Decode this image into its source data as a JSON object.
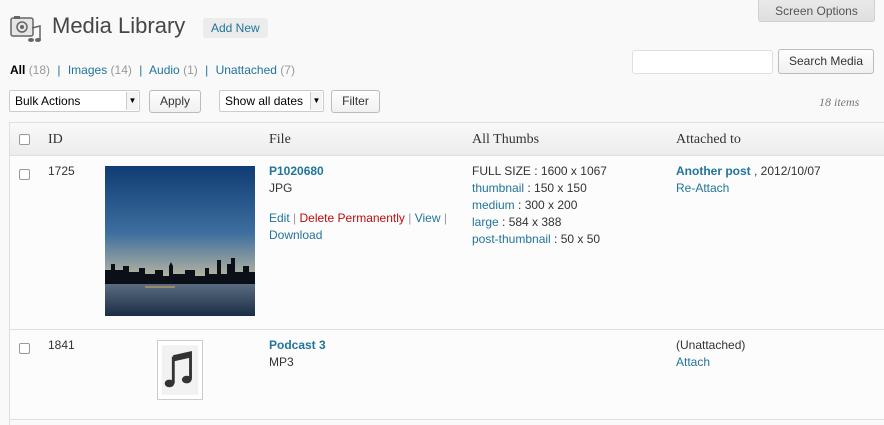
{
  "header": {
    "title": "Media Library",
    "add_new": "Add New",
    "screen_options": "Screen Options"
  },
  "filters": {
    "all": {
      "label": "All",
      "count": "(18)"
    },
    "images": {
      "label": "Images",
      "count": "(14)"
    },
    "audio": {
      "label": "Audio",
      "count": "(1)"
    },
    "unattached": {
      "label": "Unattached",
      "count": "(7)"
    }
  },
  "search": {
    "button": "Search Media",
    "value": ""
  },
  "toolbar": {
    "bulk_actions": "Bulk Actions",
    "apply": "Apply",
    "dates": "Show all dates",
    "filter": "Filter",
    "items_count": "18 items"
  },
  "table": {
    "headers": {
      "id": "ID",
      "file": "File",
      "thumbs": "All Thumbs",
      "attached": "Attached to"
    },
    "rows": [
      {
        "id": "1725",
        "title": "P1020680",
        "type": "JPG",
        "actions": {
          "edit": "Edit",
          "delete": "Delete Permanently",
          "view": "View",
          "download": "Download"
        },
        "thumbs": {
          "full": "FULL SIZE : 1600 x 1067",
          "thumbnail": {
            "label": "thumbnail",
            "size": " : 150 x 150"
          },
          "medium": {
            "label": "medium",
            "size": " : 300 x 200"
          },
          "large": {
            "label": "large",
            "size": " : 584 x 388"
          },
          "post_thumbnail": {
            "label": "post-thumbnail",
            "size": " : 50 x 50"
          }
        },
        "attached": {
          "post": "Another post",
          "date": " , 2012/10/07",
          "action": "Re-Attach"
        }
      },
      {
        "id": "1841",
        "title": "Podcast 3",
        "type": "MP3",
        "attached": {
          "status": "(Unattached)",
          "action": "Attach"
        }
      }
    ]
  },
  "colors": {
    "link": "#21759b",
    "delete": "#bc0b0b",
    "background": "#f9f9f9"
  }
}
